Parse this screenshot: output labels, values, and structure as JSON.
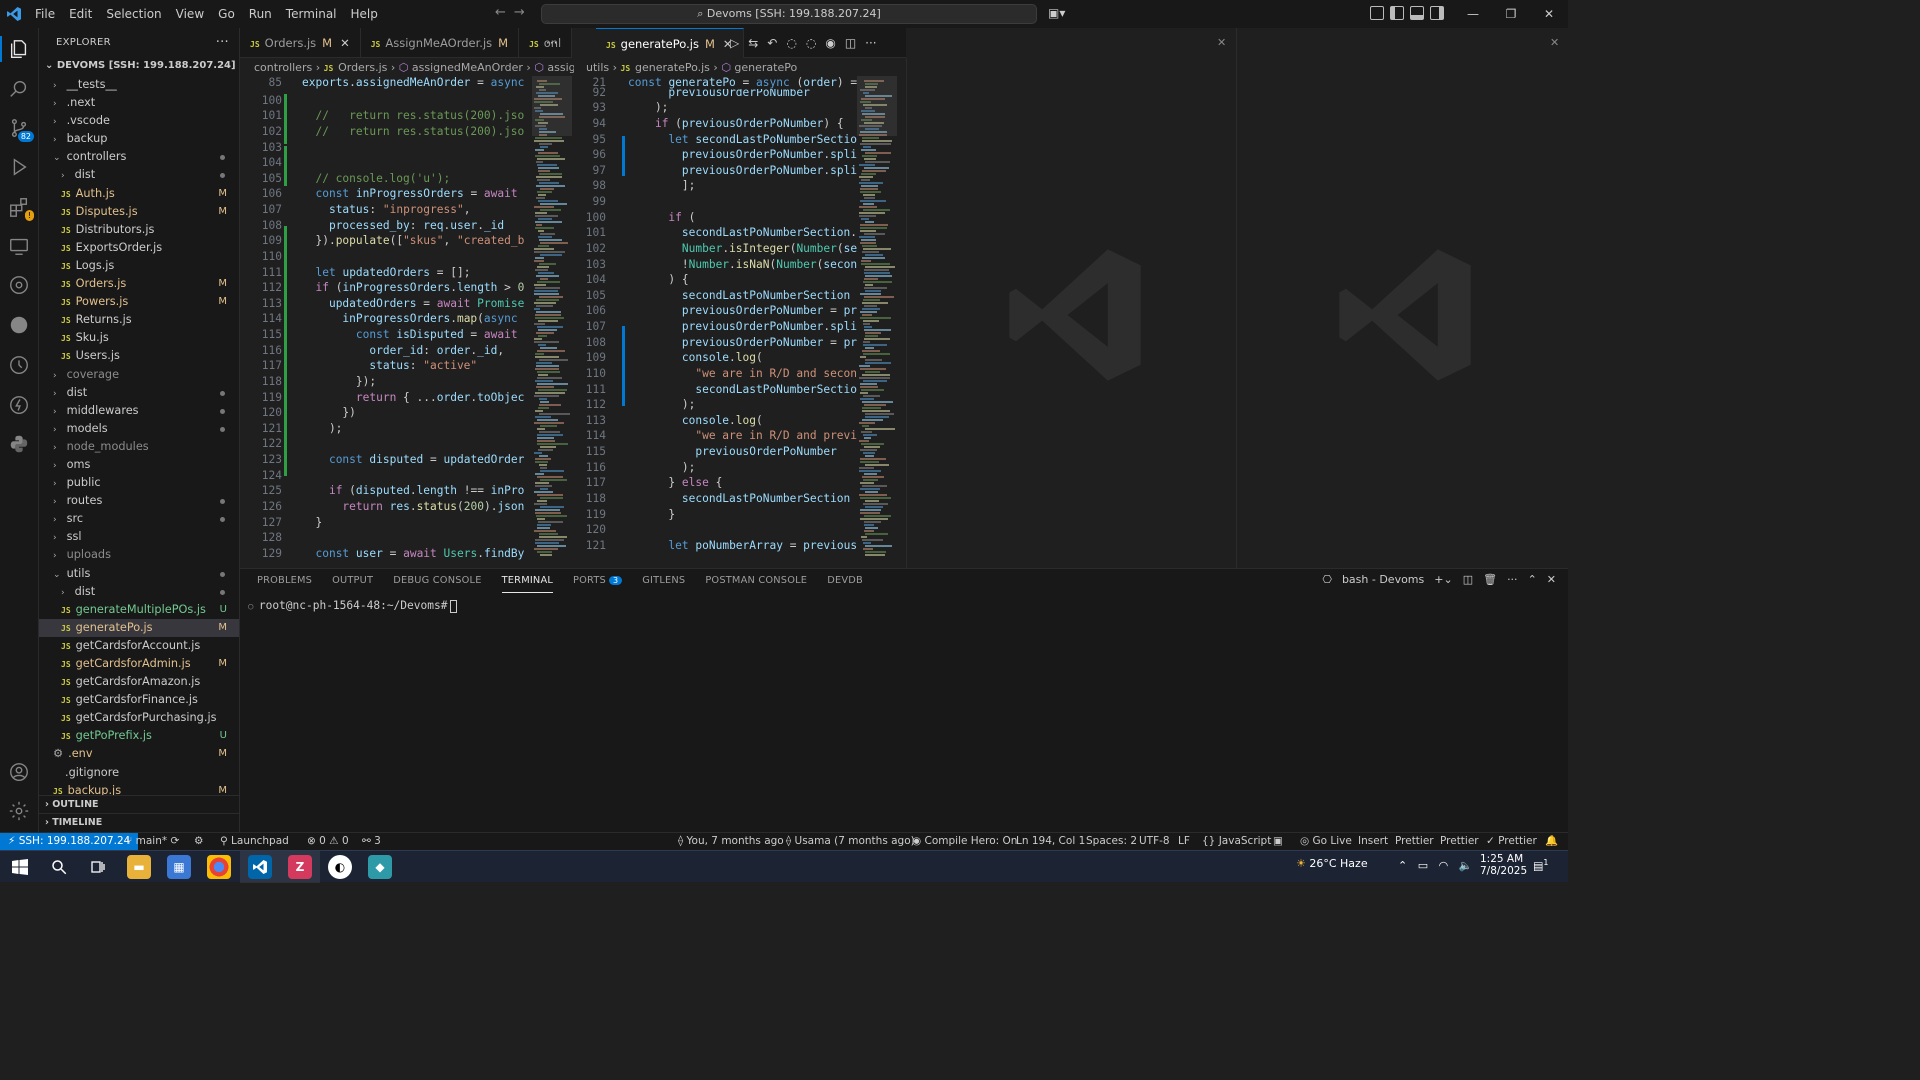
{
  "menu": [
    "File",
    "Edit",
    "Selection",
    "View",
    "Go",
    "Run",
    "Terminal",
    "Help"
  ],
  "command_center": "Devoms [SSH: 199.188.207.24]",
  "explorer": {
    "title": "EXPLORER",
    "root": "DEVOMS [SSH: 199.188.207.24]",
    "items": [
      {
        "name": "__tests__",
        "type": "folder",
        "depth": 0,
        "open": false
      },
      {
        "name": ".next",
        "type": "folder",
        "depth": 0,
        "open": false
      },
      {
        "name": ".vscode",
        "type": "folder",
        "depth": 0,
        "open": false
      },
      {
        "name": "backup",
        "type": "folder",
        "depth": 0,
        "open": false
      },
      {
        "name": "controllers",
        "type": "folder",
        "depth": 0,
        "open": true,
        "mark": "dot"
      },
      {
        "name": "dist",
        "type": "folder",
        "depth": 1,
        "open": false,
        "mark": "dot"
      },
      {
        "name": "Auth.js",
        "type": "js",
        "depth": 1,
        "status": "M"
      },
      {
        "name": "Disputes.js",
        "type": "js",
        "depth": 1,
        "status": "M"
      },
      {
        "name": "Distributors.js",
        "type": "js",
        "depth": 1
      },
      {
        "name": "ExportsOrder.js",
        "type": "js",
        "depth": 1
      },
      {
        "name": "Logs.js",
        "type": "js",
        "depth": 1
      },
      {
        "name": "Orders.js",
        "type": "js",
        "depth": 1,
        "status": "M"
      },
      {
        "name": "Powers.js",
        "type": "js",
        "depth": 1,
        "status": "M"
      },
      {
        "name": "Returns.js",
        "type": "js",
        "depth": 1
      },
      {
        "name": "Sku.js",
        "type": "js",
        "depth": 1
      },
      {
        "name": "Users.js",
        "type": "js",
        "depth": 1
      },
      {
        "name": "coverage",
        "type": "folder",
        "depth": 0,
        "open": false,
        "dim": true
      },
      {
        "name": "dist",
        "type": "folder",
        "depth": 0,
        "open": false,
        "mark": "dot"
      },
      {
        "name": "middlewares",
        "type": "folder",
        "depth": 0,
        "open": false,
        "mark": "dot"
      },
      {
        "name": "models",
        "type": "folder",
        "depth": 0,
        "open": false,
        "mark": "dot"
      },
      {
        "name": "node_modules",
        "type": "folder",
        "depth": 0,
        "open": false,
        "dim": true
      },
      {
        "name": "oms",
        "type": "folder",
        "depth": 0,
        "open": false
      },
      {
        "name": "public",
        "type": "folder",
        "depth": 0,
        "open": false
      },
      {
        "name": "routes",
        "type": "folder",
        "depth": 0,
        "open": false,
        "mark": "dot"
      },
      {
        "name": "src",
        "type": "folder",
        "depth": 0,
        "open": false,
        "mark": "dot"
      },
      {
        "name": "ssl",
        "type": "folder",
        "depth": 0,
        "open": false
      },
      {
        "name": "uploads",
        "type": "folder",
        "depth": 0,
        "open": false,
        "dim": true
      },
      {
        "name": "utils",
        "type": "folder",
        "depth": 0,
        "open": true,
        "mark": "dot"
      },
      {
        "name": "dist",
        "type": "folder",
        "depth": 1,
        "open": false,
        "mark": "dot"
      },
      {
        "name": "generateMultiplePOs.js",
        "type": "js",
        "depth": 1,
        "status": "U"
      },
      {
        "name": "generatePo.js",
        "type": "js",
        "depth": 1,
        "status": "M",
        "selected": true
      },
      {
        "name": "getCardsforAccount.js",
        "type": "js",
        "depth": 1
      },
      {
        "name": "getCardsforAdmin.js",
        "type": "js",
        "depth": 1,
        "status": "M"
      },
      {
        "name": "getCardsforAmazon.js",
        "type": "js",
        "depth": 1
      },
      {
        "name": "getCardsforFinance.js",
        "type": "js",
        "depth": 1
      },
      {
        "name": "getCardsforPurchasing.js",
        "type": "js",
        "depth": 1
      },
      {
        "name": "getPoPrefix.js",
        "type": "js",
        "depth": 1,
        "status": "U"
      },
      {
        "name": ".env",
        "type": "gear",
        "depth": 0,
        "status": "M"
      },
      {
        "name": ".gitignore",
        "type": "plain",
        "depth": 0
      },
      {
        "name": "backup.js",
        "type": "js",
        "depth": 0,
        "status": "M"
      }
    ],
    "outline": "OUTLINE",
    "timeline": "TIMELINE"
  },
  "left_tabs": [
    {
      "label": "Orders.js",
      "status": "M",
      "active": false,
      "close": true
    },
    {
      "label": "AssignMeAOrder.js",
      "status": "M",
      "active": false
    },
    {
      "label": "onl",
      "status": "",
      "active": false
    }
  ],
  "right_tabs": [
    {
      "label": "generatePo.js",
      "status": "M",
      "active": true,
      "close": true
    }
  ],
  "left_crumbs": [
    "controllers",
    "Orders.js",
    "assignedMeAnOrder",
    "assigned"
  ],
  "right_crumbs": [
    "utils",
    "generatePo.js",
    "generatePo"
  ],
  "left_sticky": {
    "ln": "85",
    "text": "exports.assignedMeAnOrder = async ("
  },
  "right_sticky": {
    "ln": "21",
    "text": "const generatePo = async (order) =>"
  },
  "left_code": [
    {
      "ln": "100",
      "t": ""
    },
    {
      "ln": "101",
      "t": "  //   return res.status(200).jso"
    },
    {
      "ln": "102",
      "t": "  //   return res.status(200).jso"
    },
    {
      "ln": "103",
      "t": ""
    },
    {
      "ln": "104",
      "t": ""
    },
    {
      "ln": "105",
      "t": "  // console.log('u');"
    },
    {
      "ln": "106",
      "t": "  const inProgressOrders = await "
    },
    {
      "ln": "107",
      "t": "    status: \"inprogress\","
    },
    {
      "ln": "108",
      "t": "    processed_by: req.user._id"
    },
    {
      "ln": "109",
      "t": "  }).populate([\"skus\", \"created_b"
    },
    {
      "ln": "110",
      "t": ""
    },
    {
      "ln": "111",
      "t": "  let updatedOrders = [];"
    },
    {
      "ln": "112",
      "t": "  if (inProgressOrders.length > 0"
    },
    {
      "ln": "113",
      "t": "    updatedOrders = await Promise"
    },
    {
      "ln": "114",
      "t": "      inProgressOrders.map(async "
    },
    {
      "ln": "115",
      "t": "        const isDisputed = await "
    },
    {
      "ln": "116",
      "t": "          order_id: order._id,"
    },
    {
      "ln": "117",
      "t": "          status: \"active\""
    },
    {
      "ln": "118",
      "t": "        });"
    },
    {
      "ln": "119",
      "t": "        return { ...order.toObjec"
    },
    {
      "ln": "120",
      "t": "      })"
    },
    {
      "ln": "121",
      "t": "    );"
    },
    {
      "ln": "122",
      "t": ""
    },
    {
      "ln": "123",
      "t": "    const disputed = updatedOrder"
    },
    {
      "ln": "124",
      "t": ""
    },
    {
      "ln": "125",
      "t": "    if (disputed.length !== inPro"
    },
    {
      "ln": "126",
      "t": "      return res.status(200).json"
    },
    {
      "ln": "127",
      "t": "  }"
    },
    {
      "ln": "128",
      "t": ""
    },
    {
      "ln": "129",
      "t": "  const user = await Users.findBy"
    }
  ],
  "right_code": [
    {
      "ln": "92",
      "t": "      previousOrderPoNumber"
    },
    {
      "ln": "93",
      "t": "    );"
    },
    {
      "ln": "94",
      "t": "    if (previousOrderPoNumber) {"
    },
    {
      "ln": "95",
      "t": "      let secondLastPoNumberSectio"
    },
    {
      "ln": "96",
      "t": "        previousOrderPoNumber.spli"
    },
    {
      "ln": "97",
      "t": "        previousOrderPoNumber.spli"
    },
    {
      "ln": "98",
      "t": "        ];"
    },
    {
      "ln": "99",
      "t": ""
    },
    {
      "ln": "100",
      "t": "      if ("
    },
    {
      "ln": "101",
      "t": "        secondLastPoNumberSection."
    },
    {
      "ln": "102",
      "t": "        Number.isInteger(Number(se"
    },
    {
      "ln": "103",
      "t": "        !Number.isNaN(Number(secon"
    },
    {
      "ln": "104",
      "t": "      ) {"
    },
    {
      "ln": "105",
      "t": "        secondLastPoNumberSection "
    },
    {
      "ln": "106",
      "t": "        previousOrderPoNumber = pr"
    },
    {
      "ln": "107",
      "t": "        previousOrderPoNumber.spli"
    },
    {
      "ln": "108",
      "t": "        previousOrderPoNumber = pr"
    },
    {
      "ln": "109",
      "t": "        console.log("
    },
    {
      "ln": "110",
      "t": "          \"we are in R/D and secon"
    },
    {
      "ln": "111",
      "t": "          secondLastPoNumberSectio"
    },
    {
      "ln": "112",
      "t": "        );"
    },
    {
      "ln": "113",
      "t": "        console.log("
    },
    {
      "ln": "114",
      "t": "          \"we are in R/D and previ"
    },
    {
      "ln": "115",
      "t": "          previousOrderPoNumber"
    },
    {
      "ln": "116",
      "t": "        );"
    },
    {
      "ln": "117",
      "t": "      } else {"
    },
    {
      "ln": "118",
      "t": "        secondLastPoNumberSection "
    },
    {
      "ln": "119",
      "t": "      }"
    },
    {
      "ln": "120",
      "t": ""
    },
    {
      "ln": "121",
      "t": "      let poNumberArray = previous"
    }
  ],
  "panel": {
    "tabs": [
      "PROBLEMS",
      "OUTPUT",
      "DEBUG CONSOLE",
      "TERMINAL",
      "PORTS",
      "GITLENS",
      "POSTMAN CONSOLE",
      "DEVDB"
    ],
    "active": "TERMINAL",
    "ports_badge": "3",
    "terminal_name": "bash - Devoms",
    "prompt": "root@nc-ph-1564-48:~/Devoms#"
  },
  "status": {
    "remote": "SSH: 199.188.207.24",
    "branch": "main*",
    "launchpad": "Launchpad",
    "errors": "0",
    "warnings": "0",
    "ports": "3",
    "blame": "You, 7 months ago",
    "author": "Usama (7 months ago)",
    "compile": "Compile Hero: On",
    "position": "Ln 194, Col 1",
    "spaces": "Spaces: 2",
    "encoding": "UTF-8",
    "eol": "LF",
    "language": "JavaScript",
    "golive": "Go Live",
    "insert": "Insert",
    "prettier1": "Prettier",
    "prettier2": "Prettier",
    "prettier3": "Prettier"
  },
  "taskbar": {
    "weather": "26°C  Haze",
    "time": "1:25 AM",
    "date": "7/8/2025",
    "notif": "1"
  }
}
